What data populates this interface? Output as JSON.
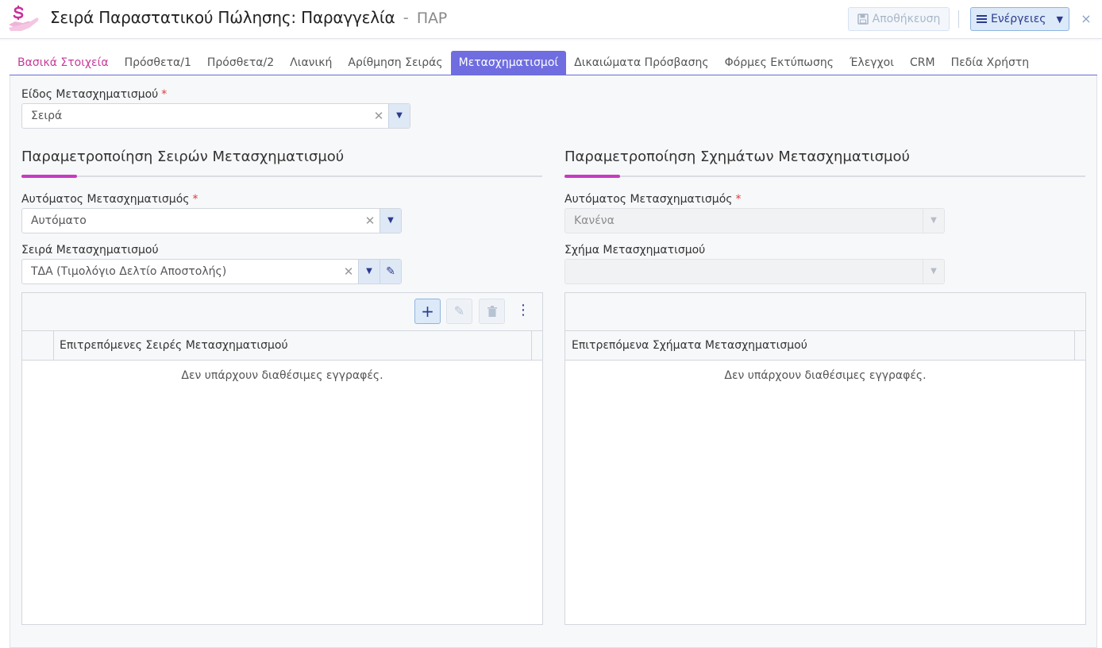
{
  "header": {
    "title": "Σειρά Παραστατικού Πώλησης: Παραγγελία",
    "separator": "-",
    "code": "ΠΑΡ",
    "save_label": "Αποθήκευση",
    "actions_label": "Ενέργειες",
    "close_glyph": "×"
  },
  "tabs": [
    {
      "label": "Βασικά Στοιχεία"
    },
    {
      "label": "Πρόσθετα/1"
    },
    {
      "label": "Πρόσθετα/2"
    },
    {
      "label": "Λιανική"
    },
    {
      "label": "Αρίθμηση Σειράς"
    },
    {
      "label": "Μετασχηματισμοί"
    },
    {
      "label": "Δικαιώματα Πρόσβασης"
    },
    {
      "label": "Φόρμες Εκτύπωσης"
    },
    {
      "label": "Έλεγχοι"
    },
    {
      "label": "CRM"
    },
    {
      "label": "Πεδία Χρήστη"
    }
  ],
  "active_tab": "Μετασχηματισμοί",
  "form": {
    "type_label": "Είδος Μετασχηματισμού",
    "type_value": "Σειρά",
    "required_mark": "*"
  },
  "left": {
    "section_title": "Παραμετροποίηση Σειρών Μετασχηματισμού",
    "auto_label": "Αυτόματος Μετασχηματισμός",
    "auto_value": "Αυτόματο",
    "series_label": "Σειρά Μετασχηματισμού",
    "series_value": "ΤΔΑ (Τιμολόγιο Δελτίο Αποστολής)",
    "grid_column": "Επιτρεπόμενες Σειρές Μετασχηματισμού",
    "grid_empty": "Δεν υπάρχουν διαθέσιμες εγγραφές."
  },
  "right": {
    "section_title": "Παραμετροποίηση Σχημάτων Μετασχηματισμού",
    "auto_label": "Αυτόματος Μετασχηματισμός",
    "auto_value": "Κανένα",
    "scheme_label": "Σχήμα Μετασχηματισμού",
    "scheme_value": "",
    "grid_column": "Επιτρεπόμενα Σχήματα Μετασχηματισμού",
    "grid_empty": "Δεν υπάρχουν διαθέσιμες εγγραφές."
  },
  "icons": {
    "logo": "hand-money-icon",
    "save": "floppy-disk-icon",
    "actions": "hamburger-menu-icon",
    "caret": "caret-down-icon",
    "clear": "clear-x-icon",
    "edit": "pencil-icon",
    "add": "plus-icon",
    "delete": "trash-icon",
    "more": "kebab-menu-icon"
  },
  "colors": {
    "accent": "#6f6de0",
    "brand_pink": "#c83ac0",
    "primary_text": "#2b3b8f",
    "required": "#e03a3a"
  }
}
